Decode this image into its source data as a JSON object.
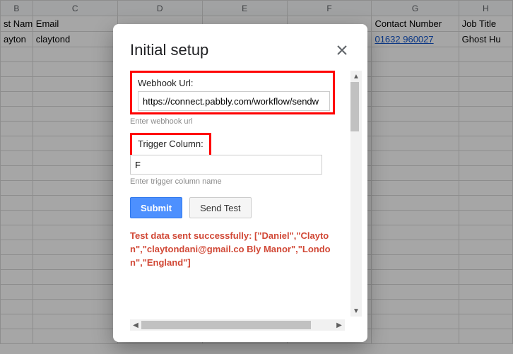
{
  "sheet": {
    "column_letters": [
      "B",
      "C",
      "D",
      "E",
      "F",
      "G",
      "H"
    ],
    "row1": {
      "b": "st Name",
      "c": "Email",
      "g": "Contact Number",
      "h": "Job Title"
    },
    "row2": {
      "b": "ayton",
      "c": "claytond",
      "g": "01632 960027",
      "h": "Ghost Hu"
    }
  },
  "dialog": {
    "title": "Initial setup",
    "webhook": {
      "label": "Webhook Url:",
      "value": "https://connect.pabbly.com/workflow/sendw",
      "helper": "Enter webhook url"
    },
    "trigger": {
      "label": "Trigger Column:",
      "value": "F",
      "helper": "Enter trigger column name"
    },
    "buttons": {
      "submit": "Submit",
      "send_test": "Send Test"
    },
    "result": "Test data sent successfully: [\"Daniel\",\"Clayton\",\"claytondani@gmail.co Bly Manor\",\"London\",\"England\"]"
  }
}
